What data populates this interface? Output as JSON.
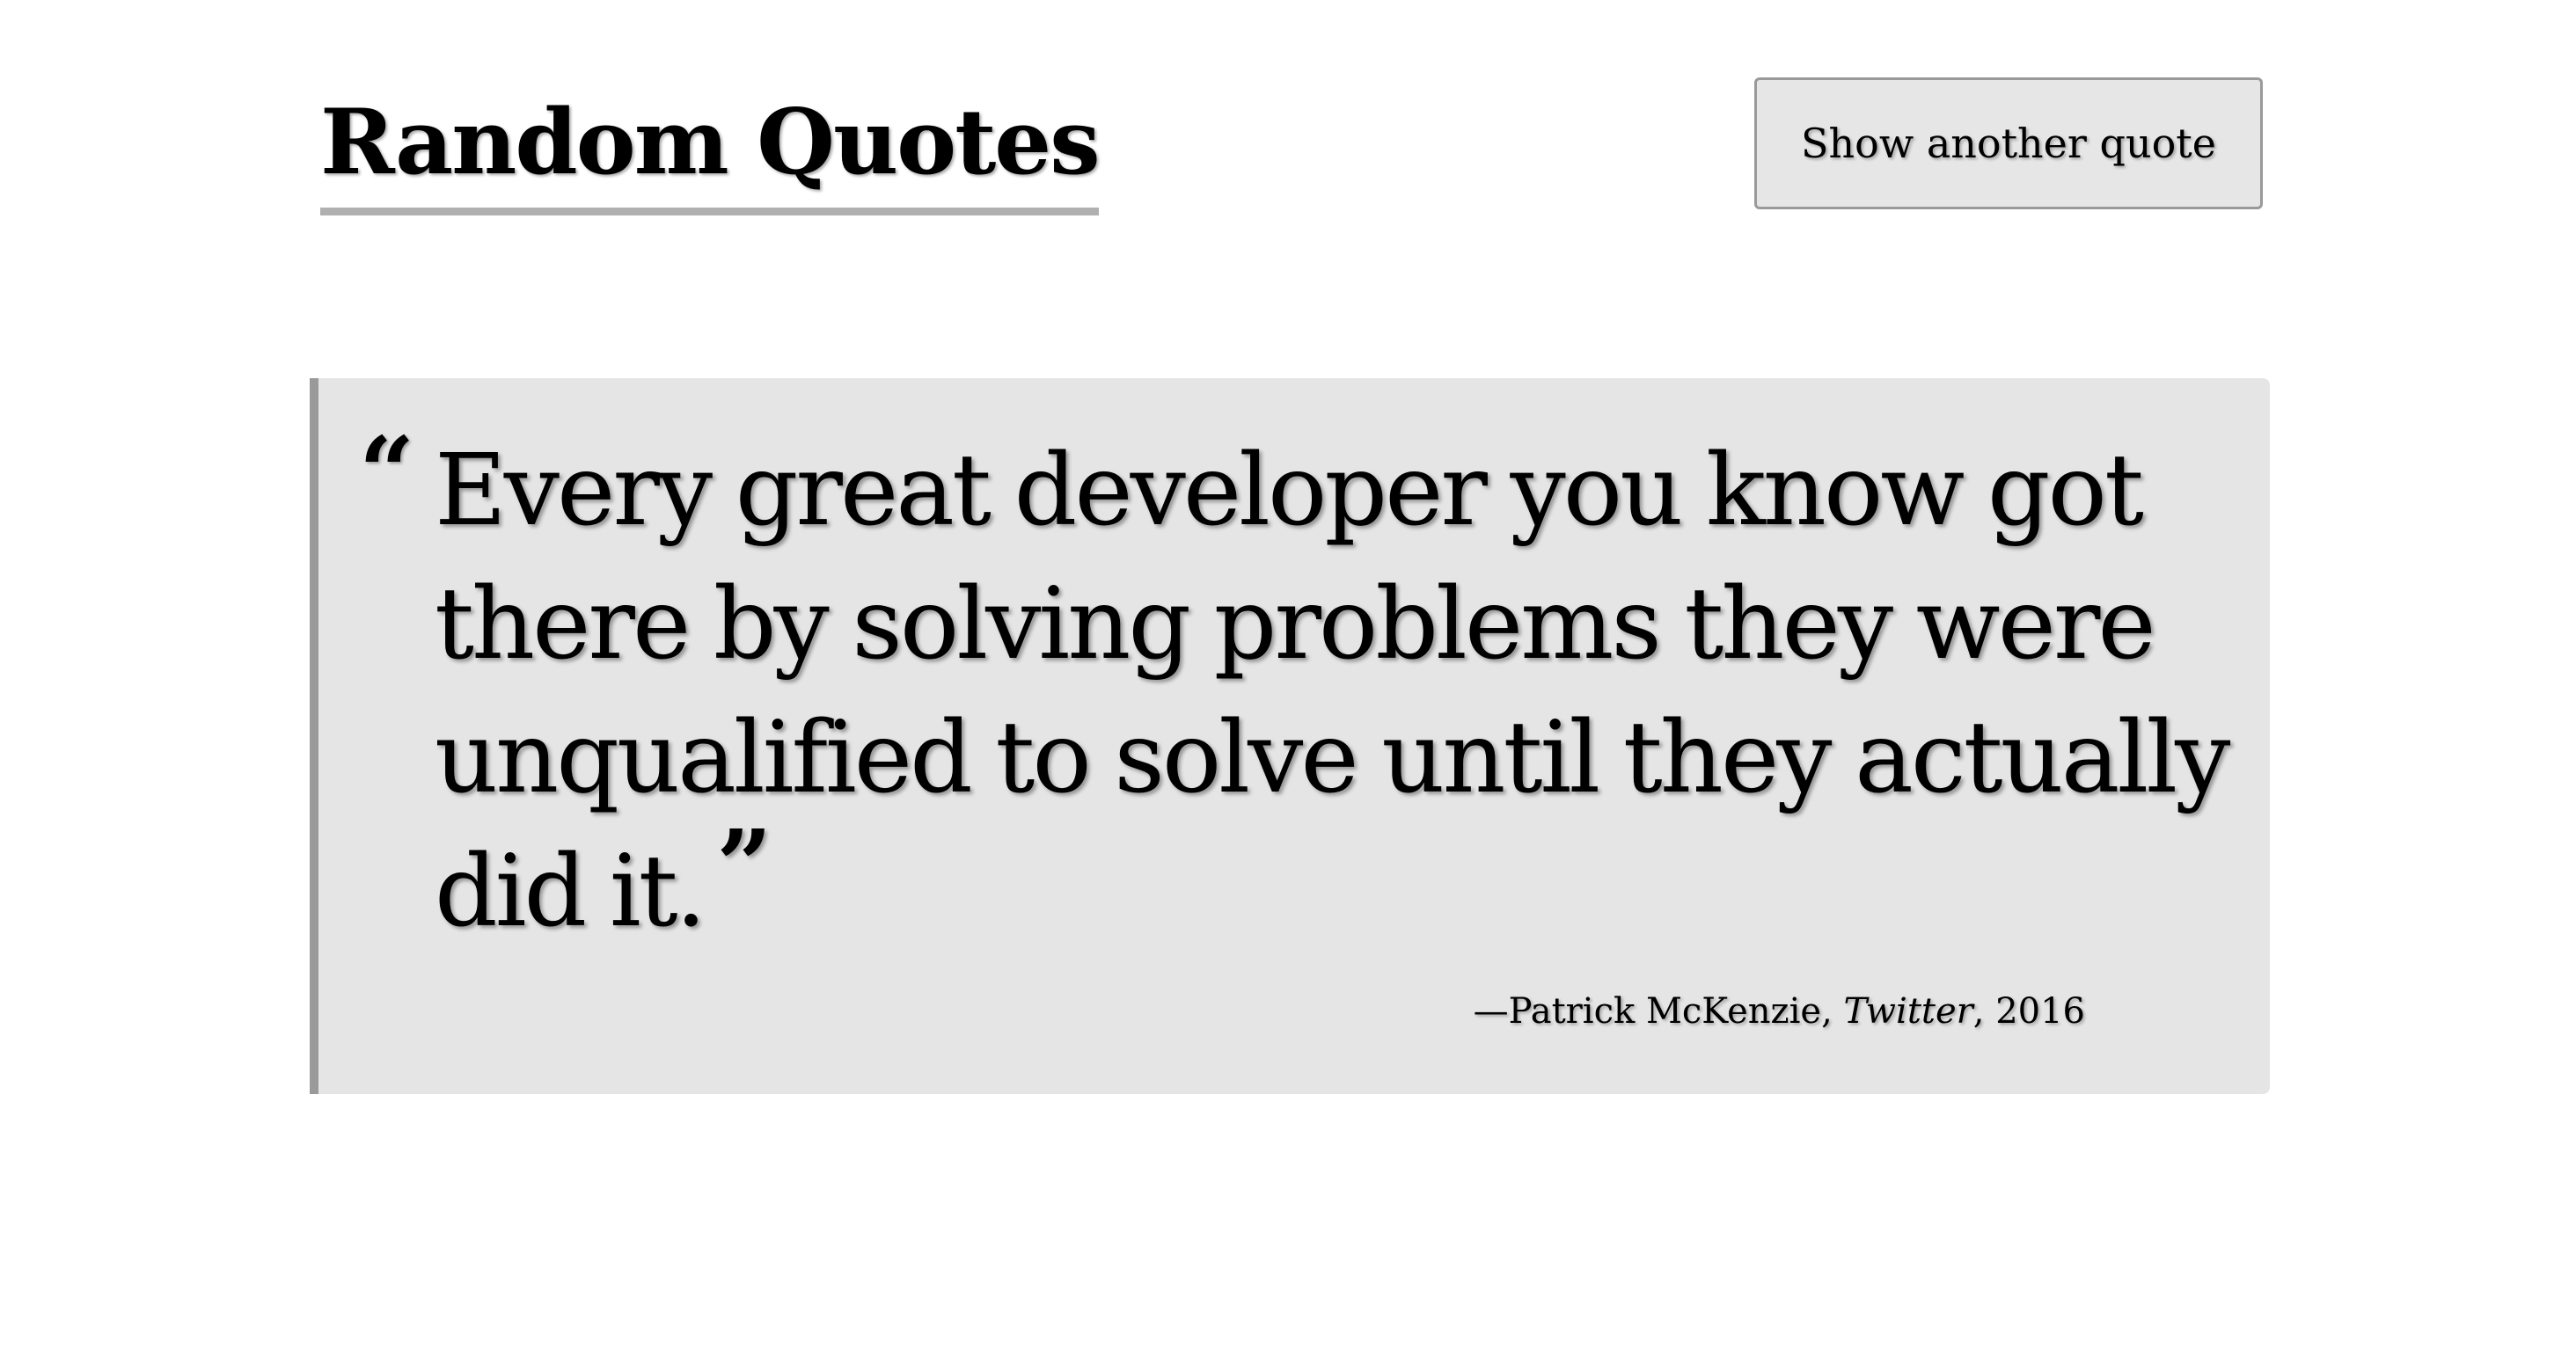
{
  "header": {
    "title": "Random Quotes",
    "next_button_label": "Show another quote"
  },
  "quote": {
    "open_mark": "“",
    "text": "Every great developer you know got there by solving problems they were unqualified to solve until they actually did it.",
    "close_mark": "”",
    "attribution": {
      "dash": "—",
      "author": "Patrick McKenzie",
      "separator_1": ", ",
      "source": "Twitter",
      "separator_2": ", ",
      "year": "2016"
    }
  },
  "colors": {
    "page_background": "#ffffff",
    "card_background": "#e5e5e5",
    "card_accent_border": "#9a9a9a",
    "title_underline": "#b0b0b0",
    "button_background": "#e6e6e6",
    "text": "#000000"
  }
}
